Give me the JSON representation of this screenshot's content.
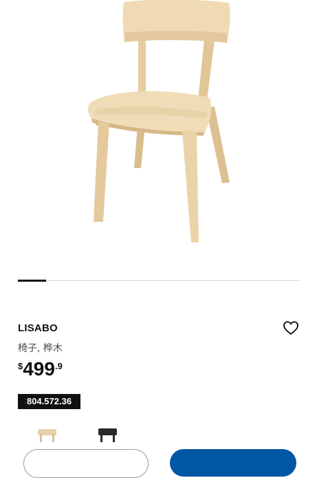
{
  "product": {
    "name": "LISABO",
    "description": "椅子, 桦木",
    "price": {
      "currency": "$",
      "integer": "499",
      "decimal": ".9"
    },
    "article_number": "804.572.36"
  },
  "gallery": {
    "progress": 0.1
  },
  "color_options": [
    {
      "name": "ash",
      "color": "#e8d0a6"
    },
    {
      "name": "black",
      "color": "#2a2a2a"
    }
  ],
  "icons": {
    "favorite": "heart-icon"
  },
  "colors": {
    "accent": "#0058a3",
    "text": "#111111",
    "wood": "#ecd5ab"
  }
}
